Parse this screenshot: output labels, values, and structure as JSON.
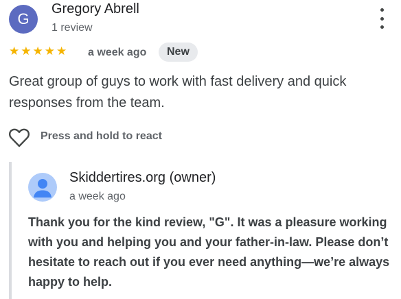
{
  "review": {
    "avatar_letter": "G",
    "avatar_color": "#5c6bc0",
    "reviewer_name": "Gregory Abrell",
    "review_count": "1 review",
    "rating": 5,
    "rating_max": 5,
    "star_color": "#f5b400",
    "date": "a week ago",
    "badge": "New",
    "text": "Great group of guys to work with fast delivery and quick responses from the team.",
    "react_label": "Press and hold to react",
    "icons": [
      "more-vert-icon",
      "star-icon",
      "heart-outline-icon"
    ]
  },
  "owner_reply": {
    "name": "Skiddertires.org (owner)",
    "date": "a week ago",
    "avatar_icon": "person-icon",
    "avatar_color": "#aecbfa",
    "text": "Thank you for the kind review, \"G\". It was a pleasure working with you and helping you and your father-in-law. Please don’t hesitate to reach out if you ever need anything—we’re always happy to help."
  }
}
